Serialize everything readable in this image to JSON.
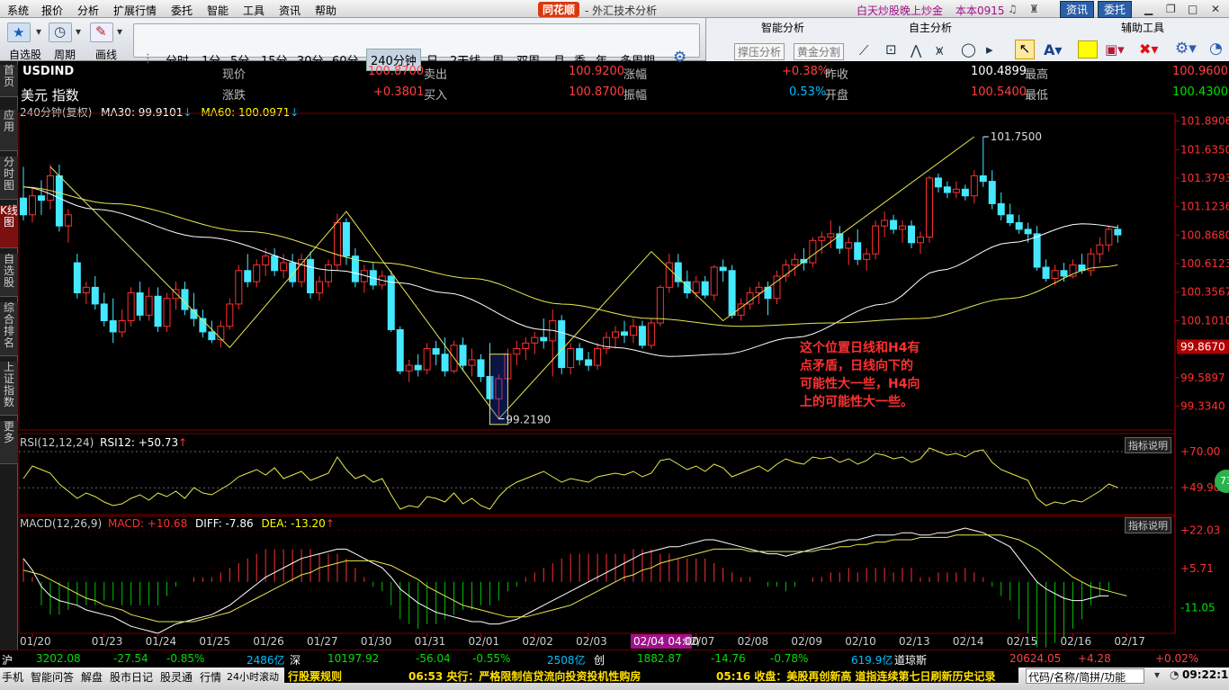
{
  "menu": {
    "items": [
      "系统",
      "报价",
      "分析",
      "扩展行情",
      "委托",
      "智能",
      "工具",
      "资讯",
      "帮助"
    ],
    "brand": "同花顺",
    "app_title": "- 外汇技术分析",
    "promo": "白天炒股晚上炒金",
    "version": "本本0915",
    "btn_news": "资讯",
    "btn_trade": "委托"
  },
  "toolbar": {
    "left_labels": [
      "自选股",
      "周期",
      "画线"
    ],
    "periods": [
      "分时",
      "1分",
      "5分",
      "15分",
      "30分",
      "60分",
      "240分钟",
      "日",
      "2天线",
      "周",
      "双周",
      "月",
      "季",
      "年",
      "多周期"
    ],
    "active_period": "240分钟",
    "smart_title": "智能分析",
    "smart_buttons": [
      "撑压分析",
      "黄金分割"
    ],
    "custom_title": "自主分析",
    "aux_title": "辅助工具"
  },
  "leftnav": [
    "首页",
    "应用",
    "分时图",
    "K线图",
    "自选股",
    "综合排名",
    "上证指数",
    "更多"
  ],
  "quote": {
    "symbol": "USDIND",
    "name": "美元 指数",
    "l_now": "现价",
    "now": "100.8700",
    "l_sell": "卖出",
    "sell": "100.9200",
    "l_chg_pct": "涨幅",
    "chg_pct": "+0.38%",
    "l_prev": "昨收",
    "prev": "100.4899",
    "l_high": "最高",
    "high": "100.9600",
    "l_chg": "涨跌",
    "chg": "+0.3801",
    "l_buy": "买入",
    "buy": "100.8700",
    "l_amp": "振幅",
    "amp": "0.53%",
    "l_open": "开盘",
    "open": "100.5400",
    "l_low": "最低",
    "low": "100.4300"
  },
  "ma_line": {
    "period": "240分钟(复权)",
    "ma30": "MA30: 99.9101",
    "ma60": "MA60: 100.0971"
  },
  "colors": {
    "up": "#ff3030",
    "down": "#44e8ff",
    "ma30": "#ffffff",
    "ma60": "#e8e850",
    "zig": "#e8e850",
    "annot": "#ff3030",
    "grid": "#7a0000"
  },
  "chart_data": {
    "type": "candlestick",
    "price_ylim": [
      99.12,
      101.96
    ],
    "price_ticks": [
      "101.8906",
      "101.6350",
      "101.3793",
      "101.1236",
      "100.8680",
      "100.6123",
      "100.3567",
      "100.1010",
      "99.8670",
      "99.5897",
      "99.3340"
    ],
    "current_price_label": "99.8670",
    "x_dates": [
      "01/20",
      "01/23",
      "01/24",
      "01/25",
      "01/26",
      "01/27",
      "01/30",
      "01/31",
      "02/01",
      "02/02",
      "02/03",
      "02/04 04:00",
      "02/07",
      "02/08",
      "02/09",
      "02/10",
      "02/13",
      "02/14",
      "02/15",
      "02/16",
      "02/17"
    ],
    "candles": [
      [
        101.2,
        101.48,
        101.0,
        101.05
      ],
      [
        101.05,
        101.3,
        100.98,
        101.22
      ],
      [
        101.22,
        101.36,
        101.05,
        101.18
      ],
      [
        101.18,
        101.5,
        101.1,
        101.4
      ],
      [
        101.4,
        101.5,
        100.9,
        100.95
      ],
      [
        100.95,
        101.1,
        100.8,
        101.05
      ],
      [
        100.62,
        100.7,
        100.3,
        100.35
      ],
      [
        100.35,
        100.45,
        100.25,
        100.4
      ],
      [
        100.4,
        100.5,
        100.2,
        100.25
      ],
      [
        100.25,
        100.35,
        100.05,
        100.1
      ],
      [
        100.1,
        100.3,
        99.9,
        100.0
      ],
      [
        100.0,
        100.2,
        99.95,
        100.1
      ],
      [
        100.1,
        100.4,
        100.05,
        100.35
      ],
      [
        100.35,
        100.45,
        100.1,
        100.15
      ],
      [
        100.15,
        100.4,
        100.1,
        100.32
      ],
      [
        100.32,
        100.4,
        100.0,
        100.05
      ],
      [
        100.05,
        100.35,
        100.0,
        100.3
      ],
      [
        100.3,
        100.45,
        100.2,
        100.38
      ],
      [
        100.38,
        100.45,
        100.15,
        100.2
      ],
      [
        100.2,
        100.35,
        100.05,
        100.12
      ],
      [
        100.12,
        100.2,
        99.95,
        100.0
      ],
      [
        100.0,
        100.1,
        99.9,
        99.93
      ],
      [
        99.93,
        100.1,
        99.86,
        100.05
      ],
      [
        100.05,
        100.3,
        100.02,
        100.25
      ],
      [
        100.25,
        100.6,
        100.2,
        100.55
      ],
      [
        100.55,
        100.7,
        100.4,
        100.45
      ],
      [
        100.45,
        100.65,
        100.4,
        100.6
      ],
      [
        100.6,
        100.75,
        100.5,
        100.68
      ],
      [
        100.68,
        100.75,
        100.5,
        100.55
      ],
      [
        100.55,
        100.7,
        100.48,
        100.62
      ],
      [
        100.62,
        100.7,
        100.4,
        100.45
      ],
      [
        100.45,
        100.7,
        100.4,
        100.65
      ],
      [
        100.65,
        100.72,
        100.3,
        100.35
      ],
      [
        100.35,
        100.5,
        100.28,
        100.45
      ],
      [
        100.45,
        100.65,
        100.4,
        100.6
      ],
      [
        100.6,
        101.06,
        100.55,
        100.98
      ],
      [
        100.98,
        101.02,
        100.6,
        100.68
      ],
      [
        100.68,
        100.75,
        100.4,
        100.45
      ],
      [
        100.45,
        100.6,
        100.35,
        100.55
      ],
      [
        100.55,
        100.62,
        100.38,
        100.42
      ],
      [
        100.42,
        100.55,
        100.38,
        100.5
      ],
      [
        100.5,
        100.55,
        100.0,
        100.02
      ],
      [
        100.02,
        100.05,
        99.62,
        99.65
      ],
      [
        99.65,
        99.75,
        99.55,
        99.7
      ],
      [
        99.7,
        99.8,
        99.6,
        99.66
      ],
      [
        99.66,
        99.9,
        99.62,
        99.85
      ],
      [
        99.85,
        99.92,
        99.7,
        99.8
      ],
      [
        99.8,
        99.95,
        99.6,
        99.65
      ],
      [
        99.65,
        99.92,
        99.63,
        99.88
      ],
      [
        99.88,
        99.95,
        99.65,
        99.7
      ],
      [
        99.7,
        99.85,
        99.6,
        99.75
      ],
      [
        99.75,
        99.8,
        99.55,
        99.6
      ],
      [
        99.6,
        99.9,
        99.25,
        99.4
      ],
      [
        99.4,
        99.62,
        99.22,
        99.58
      ],
      [
        99.58,
        99.85,
        99.55,
        99.8
      ],
      [
        99.8,
        99.92,
        99.7,
        99.85
      ],
      [
        99.85,
        99.95,
        99.75,
        99.9
      ],
      [
        99.9,
        100.0,
        99.8,
        99.95
      ],
      [
        99.95,
        100.12,
        99.85,
        99.92
      ],
      [
        99.92,
        100.2,
        99.6,
        100.1
      ],
      [
        100.1,
        100.15,
        99.62,
        99.68
      ],
      [
        99.68,
        99.9,
        99.62,
        99.85
      ],
      [
        99.85,
        99.9,
        99.7,
        99.75
      ],
      [
        99.75,
        99.82,
        99.65,
        99.7
      ],
      [
        99.7,
        99.9,
        99.66,
        99.85
      ],
      [
        99.85,
        100.0,
        99.8,
        99.95
      ],
      [
        99.95,
        100.05,
        99.85,
        100.0
      ],
      [
        100.0,
        100.1,
        99.9,
        99.97
      ],
      [
        99.97,
        100.12,
        99.9,
        100.05
      ],
      [
        100.05,
        100.1,
        99.85,
        99.88
      ],
      [
        99.88,
        100.12,
        99.85,
        100.08
      ],
      [
        100.08,
        100.42,
        100.05,
        100.4
      ],
      [
        100.4,
        100.7,
        100.35,
        100.62
      ],
      [
        100.62,
        100.7,
        100.4,
        100.45
      ],
      [
        100.45,
        100.55,
        100.3,
        100.35
      ],
      [
        100.35,
        100.5,
        100.3,
        100.45
      ],
      [
        100.45,
        100.5,
        100.3,
        100.33
      ],
      [
        100.33,
        100.6,
        100.28,
        100.58
      ],
      [
        100.58,
        100.65,
        100.45,
        100.55
      ],
      [
        100.55,
        100.6,
        100.12,
        100.15
      ],
      [
        100.15,
        100.3,
        100.1,
        100.25
      ],
      [
        100.25,
        100.4,
        100.2,
        100.35
      ],
      [
        100.35,
        100.45,
        100.25,
        100.4
      ],
      [
        100.4,
        100.45,
        100.15,
        100.3
      ],
      [
        100.3,
        100.55,
        100.25,
        100.5
      ],
      [
        100.5,
        100.65,
        100.45,
        100.6
      ],
      [
        100.6,
        100.7,
        100.5,
        100.65
      ],
      [
        100.65,
        100.75,
        100.55,
        100.62
      ],
      [
        100.62,
        100.85,
        100.58,
        100.82
      ],
      [
        100.82,
        100.9,
        100.7,
        100.85
      ],
      [
        100.85,
        101.0,
        100.75,
        100.88
      ],
      [
        100.88,
        100.95,
        100.7,
        100.75
      ],
      [
        100.75,
        100.85,
        100.6,
        100.8
      ],
      [
        100.8,
        100.92,
        100.6,
        100.65
      ],
      [
        100.65,
        100.75,
        100.55,
        100.7
      ],
      [
        100.7,
        101.0,
        100.65,
        100.95
      ],
      [
        100.95,
        101.08,
        100.85,
        101.0
      ],
      [
        101.0,
        101.05,
        100.88,
        100.92
      ],
      [
        100.92,
        101.0,
        100.8,
        100.95
      ],
      [
        100.95,
        101.0,
        100.75,
        100.8
      ],
      [
        100.8,
        100.9,
        100.7,
        100.85
      ],
      [
        100.85,
        101.4,
        100.8,
        101.38
      ],
      [
        101.38,
        101.42,
        101.25,
        101.3
      ],
      [
        101.3,
        101.35,
        101.2,
        101.25
      ],
      [
        101.25,
        101.35,
        101.2,
        101.28
      ],
      [
        101.28,
        101.32,
        101.18,
        101.22
      ],
      [
        101.22,
        101.45,
        101.15,
        101.4
      ],
      [
        101.4,
        101.75,
        101.3,
        101.35
      ],
      [
        101.35,
        101.45,
        101.1,
        101.15
      ],
      [
        101.15,
        101.25,
        101.0,
        101.05
      ],
      [
        101.05,
        101.15,
        100.95,
        100.98
      ],
      [
        100.98,
        101.05,
        100.88,
        100.92
      ],
      [
        100.92,
        100.98,
        100.8,
        100.88
      ],
      [
        100.88,
        100.95,
        100.55,
        100.58
      ],
      [
        100.58,
        100.65,
        100.45,
        100.48
      ],
      [
        100.48,
        100.6,
        100.42,
        100.55
      ],
      [
        100.55,
        100.62,
        100.45,
        100.5
      ],
      [
        100.5,
        100.65,
        100.48,
        100.6
      ],
      [
        100.6,
        100.7,
        100.52,
        100.55
      ],
      [
        100.55,
        100.75,
        100.5,
        100.7
      ],
      [
        100.7,
        100.85,
        100.62,
        100.78
      ],
      [
        100.78,
        100.95,
        100.72,
        100.92
      ],
      [
        100.92,
        100.96,
        100.8,
        100.87
      ]
    ],
    "ma30_ctrl": [
      [
        101.3,
        0
      ],
      [
        101.1,
        8
      ],
      [
        100.85,
        20
      ],
      [
        100.55,
        35
      ],
      [
        100.44,
        42
      ],
      [
        100.35,
        47
      ],
      [
        100.02,
        58
      ],
      [
        99.86,
        66
      ],
      [
        99.78,
        72
      ],
      [
        99.8,
        78
      ],
      [
        99.95,
        86
      ],
      [
        100.25,
        96
      ],
      [
        100.55,
        102
      ],
      [
        100.8,
        110
      ],
      [
        100.97,
        118
      ],
      [
        100.9,
        126
      ]
    ],
    "ma60_ctrl": [
      [
        101.3,
        0
      ],
      [
        101.15,
        10
      ],
      [
        100.9,
        25
      ],
      [
        100.62,
        40
      ],
      [
        100.48,
        50
      ],
      [
        100.25,
        60
      ],
      [
        100.12,
        70
      ],
      [
        100.05,
        80
      ],
      [
        100.08,
        90
      ],
      [
        100.12,
        100
      ],
      [
        100.3,
        110
      ],
      [
        100.58,
        120
      ],
      [
        100.66,
        126
      ]
    ],
    "zigzag": [
      [
        101.48,
        3
      ],
      [
        99.86,
        23
      ],
      [
        101.08,
        36
      ],
      [
        99.22,
        53
      ],
      [
        100.72,
        70
      ],
      [
        100.1,
        78
      ],
      [
        101.75,
        106
      ]
    ],
    "box_idx": 53,
    "mark_high": "101.7500",
    "mark_low": "99.2190",
    "annotation": [
      "这个位置日线和H4有",
      "点矛盾，日线向下的",
      "可能性大一些，H4向",
      "上的可能性大一些。"
    ],
    "rsi": {
      "label": "RSI(12,12,24)",
      "value_label": "RSI12: +50.73",
      "ylim": [
        35,
        80
      ],
      "ticks": [
        "+70.00",
        "+49.90"
      ],
      "badge": "73",
      "values": [
        55,
        62,
        60,
        58,
        52,
        48,
        44,
        47,
        45,
        42,
        40,
        41,
        44,
        46,
        43,
        47,
        45,
        48,
        44,
        50,
        47,
        46,
        49,
        52,
        56,
        58,
        60,
        57,
        61,
        55,
        57,
        59,
        54,
        56,
        58,
        67,
        60,
        55,
        57,
        53,
        55,
        46,
        38,
        40,
        39,
        45,
        44,
        42,
        47,
        41,
        44,
        40,
        38,
        45,
        50,
        53,
        55,
        57,
        59,
        56,
        53,
        55,
        54,
        53,
        56,
        57,
        58,
        57,
        59,
        56,
        58,
        65,
        66,
        63,
        60,
        62,
        59,
        63,
        61,
        56,
        58,
        60,
        62,
        59,
        63,
        66,
        64,
        63,
        67,
        66,
        67,
        64,
        66,
        63,
        65,
        69,
        68,
        66,
        67,
        64,
        66,
        72,
        70,
        68,
        69,
        67,
        70,
        71,
        64,
        60,
        58,
        56,
        54,
        44,
        40,
        42,
        41,
        43,
        42,
        45,
        48,
        52,
        50
      ]
    },
    "macd": {
      "label": "MACD(12,26,9)",
      "macd_label": "MACD: +10.68",
      "diff_label": "DIFF: -7.86",
      "dea_label": "DEA: -13.20",
      "ylim": [
        -22,
        28
      ],
      "ticks": [
        "+22.03",
        "+5.71",
        "-11.05"
      ],
      "diff": [
        10,
        5,
        -2,
        -6,
        -8,
        -9,
        -10,
        -12,
        -13,
        -14,
        -15,
        -17,
        -19,
        -20,
        -21,
        -22,
        -20,
        -18,
        -17,
        -16,
        -15,
        -14,
        -12,
        -10,
        -7,
        -4,
        -1,
        2,
        4,
        6,
        8,
        10,
        11,
        12,
        13,
        14,
        14,
        12,
        10,
        8,
        6,
        2,
        -3,
        -6,
        -9,
        -11,
        -13,
        -14,
        -15,
        -16,
        -17,
        -17,
        -18,
        -18,
        -17,
        -16,
        -14,
        -12,
        -10,
        -8,
        -6,
        -4,
        -2,
        0,
        2,
        4,
        6,
        8,
        10,
        12,
        13,
        14,
        15,
        15,
        16,
        17,
        18,
        18,
        17,
        16,
        15,
        14,
        13,
        12,
        12,
        11,
        12,
        13,
        14,
        15,
        16,
        17,
        18,
        18,
        19,
        20,
        20,
        20,
        21,
        21,
        20,
        20,
        21,
        21,
        22,
        23,
        22,
        21,
        19,
        17,
        15,
        10,
        5,
        0,
        -3,
        -5,
        -7,
        -8,
        -8,
        -7,
        -6,
        -6
      ],
      "dea": [
        5,
        4,
        3,
        1,
        -1,
        -3,
        -5,
        -7,
        -8,
        -10,
        -11,
        -12,
        -14,
        -15,
        -16,
        -17,
        -17,
        -17,
        -17,
        -17,
        -16,
        -15,
        -14,
        -13,
        -11,
        -9,
        -7,
        -5,
        -3,
        -1,
        1,
        3,
        4,
        6,
        7,
        8,
        9,
        9,
        9,
        9,
        8,
        7,
        5,
        3,
        1,
        -2,
        -4,
        -6,
        -8,
        -10,
        -11,
        -12,
        -13,
        -14,
        -15,
        -15,
        -15,
        -14,
        -13,
        -12,
        -11,
        -10,
        -8,
        -6,
        -4,
        -2,
        0,
        2,
        3,
        5,
        6,
        8,
        9,
        10,
        11,
        12,
        13,
        14,
        14,
        14,
        14,
        13,
        13,
        13,
        13,
        13,
        13,
        13,
        13,
        14,
        14,
        15,
        15,
        16,
        16,
        17,
        17,
        18,
        18,
        18,
        19,
        19,
        19,
        19,
        20,
        20,
        20,
        20,
        20,
        20,
        19,
        18,
        16,
        14,
        11,
        8,
        5,
        2,
        0,
        -2,
        -3,
        -4,
        -5,
        -6
      ]
    }
  },
  "status_quotes": {
    "sh_label": "沪",
    "sh": "3202.08",
    "sh_chg": "-27.54",
    "sh_pct": "-0.85%",
    "sh_vol": "2486亿",
    "sz_label": "深",
    "sz": "10197.92",
    "sz_chg": "-56.04",
    "sz_pct": "-0.55%",
    "sz_vol": "2508亿",
    "cy_label": "创",
    "cy": "1882.87",
    "cy_chg": "-14.76",
    "cy_pct": "-0.78%",
    "cy_vol": "619.9亿",
    "dj_label": "道琼斯",
    "dj": "20624.05",
    "dj_chg": "+4.28",
    "dj_pct": "+0.02%"
  },
  "footer": {
    "items": [
      "手机",
      "智能问答",
      "解盘",
      "股市日记",
      "股灵通",
      "行情",
      "24小时滚动"
    ],
    "rules": "行股票规则",
    "news1": "06:53 央行：严格限制信贷流向投资投机性购房",
    "news2": "05:16 收盘：美股再创新高 道指连续第七日刷新历史记录",
    "search_placeholder": "代码/名称/简拼/功能",
    "clock": "09:22:19",
    "btn_indicator": "指标说明"
  }
}
